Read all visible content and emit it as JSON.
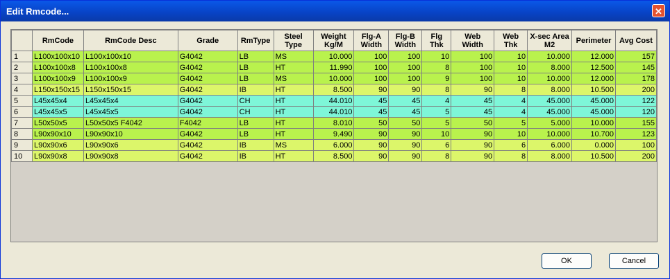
{
  "window": {
    "title": "Edit Rmcode...",
    "close": "✕"
  },
  "grid": {
    "columns": [
      "RmCode",
      "RmCode Desc",
      "Grade",
      "RmType",
      "Steel\nType",
      "Weight\nKg/M",
      "Flg-A\nWidth",
      "Flg-B\nWidth",
      "Flg\nThk",
      "Web\nWidth",
      "Web\nThk",
      "X-sec Area\nM2",
      "Perimeter",
      "Avg Cost"
    ],
    "rows": [
      {
        "no": "1",
        "cells": [
          "L100x100x10",
          "L100x100x10",
          "G4042",
          "LB",
          "MS",
          "10.000",
          "100",
          "100",
          "10",
          "100",
          "10",
          "10.000",
          "12.000",
          "157"
        ],
        "color": "green"
      },
      {
        "no": "2",
        "cells": [
          "L100x100x8",
          "L100x100x8",
          "G4042",
          "LB",
          "HT",
          "11.990",
          "100",
          "100",
          "8",
          "100",
          "10",
          "8.000",
          "12.500",
          "145"
        ],
        "color": "green"
      },
      {
        "no": "3",
        "cells": [
          "L100x100x9",
          "L100x100x9",
          "G4042",
          "LB",
          "MS",
          "10.000",
          "100",
          "100",
          "9",
          "100",
          "10",
          "10.000",
          "12.000",
          "178"
        ],
        "color": "green"
      },
      {
        "no": "4",
        "cells": [
          "L150x150x15",
          "L150x150x15",
          "G4042",
          "IB",
          "HT",
          "8.500",
          "90",
          "90",
          "8",
          "90",
          "8",
          "8.000",
          "10.500",
          "200"
        ],
        "color": "lime"
      },
      {
        "no": "5",
        "cells": [
          "L45x45x4",
          "L45x45x4",
          "G4042",
          "CH",
          "HT",
          "44.010",
          "45",
          "45",
          "4",
          "45",
          "4",
          "45.000",
          "45.000",
          "122"
        ],
        "color": "cyan"
      },
      {
        "no": "6",
        "cells": [
          "L45x45x5",
          "L45x45x5",
          "G4042",
          "CH",
          "HT",
          "44.010",
          "45",
          "45",
          "5",
          "45",
          "4",
          "45.000",
          "45.000",
          "120"
        ],
        "color": "cyan"
      },
      {
        "no": "7",
        "cells": [
          "L50x50x5",
          "L50x50x5 F4042",
          "F4042",
          "LB",
          "HT",
          "8.010",
          "50",
          "50",
          "5",
          "50",
          "5",
          "5.000",
          "10.000",
          "155"
        ],
        "color": "green"
      },
      {
        "no": "8",
        "cells": [
          "L90x90x10",
          "L90x90x10",
          "G4042",
          "LB",
          "HT",
          "9.490",
          "90",
          "90",
          "10",
          "90",
          "10",
          "10.000",
          "10.700",
          "123"
        ],
        "color": "green"
      },
      {
        "no": "9",
        "cells": [
          "L90x90x6",
          "L90x90x6",
          "G4042",
          "IB",
          "MS",
          "6.000",
          "90",
          "90",
          "6",
          "90",
          "6",
          "6.000",
          "0.000",
          "100"
        ],
        "color": "lime"
      },
      {
        "no": "10",
        "cells": [
          "L90x90x8",
          "L90x90x8",
          "G4042",
          "IB",
          "HT",
          "8.500",
          "90",
          "90",
          "8",
          "90",
          "8",
          "8.000",
          "10.500",
          "200"
        ],
        "color": "lime"
      }
    ]
  },
  "buttons": {
    "ok": "OK",
    "cancel": "Cancel"
  }
}
